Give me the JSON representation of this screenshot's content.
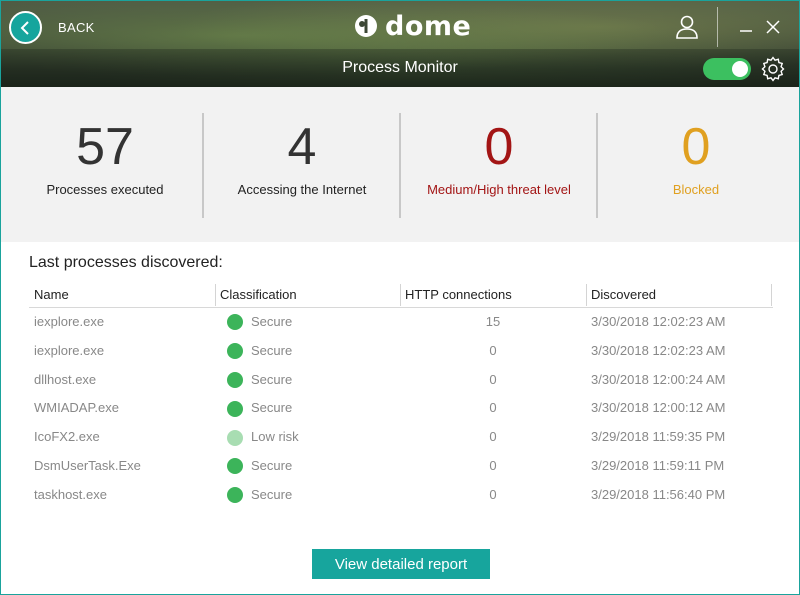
{
  "header": {
    "back_label": "BACK",
    "brand": "dome",
    "page_title": "Process Monitor",
    "toggle_on": true
  },
  "stats": [
    {
      "value": "57",
      "label": "Processes executed",
      "color": "#333333",
      "label_color": "#222222"
    },
    {
      "value": "4",
      "label": "Accessing the Internet",
      "color": "#333333",
      "label_color": "#222222"
    },
    {
      "value": "0",
      "label": "Medium/High threat level",
      "color": "#a31515",
      "label_color": "#a31515"
    },
    {
      "value": "0",
      "label": "Blocked",
      "color": "#e0a020",
      "label_color": "#e0a020"
    }
  ],
  "table": {
    "title": "Last processes discovered:",
    "columns": [
      "Name",
      "Classification",
      "HTTP connections",
      "Discovered"
    ],
    "rows": [
      {
        "name": "iexplore.exe",
        "classification": "Secure",
        "http": "15",
        "discovered": "3/30/2018 12:02:23 AM"
      },
      {
        "name": "iexplore.exe",
        "classification": "Secure",
        "http": "0",
        "discovered": "3/30/2018 12:02:23 AM"
      },
      {
        "name": "dllhost.exe",
        "classification": "Secure",
        "http": "0",
        "discovered": "3/30/2018 12:00:24 AM"
      },
      {
        "name": "WMIADAP.exe",
        "classification": "Secure",
        "http": "0",
        "discovered": "3/30/2018 12:00:12 AM"
      },
      {
        "name": "IcoFX2.exe",
        "classification": "Low risk",
        "http": "0",
        "discovered": "3/29/2018 11:59:35 PM"
      },
      {
        "name": "DsmUserTask.Exe",
        "classification": "Secure",
        "http": "0",
        "discovered": "3/29/2018 11:59:11 PM"
      },
      {
        "name": "taskhost.exe",
        "classification": "Secure",
        "http": "0",
        "discovered": "3/29/2018 11:56:40 PM"
      }
    ]
  },
  "status_colors": {
    "Secure": "#3cb45a",
    "Low risk": "#a8ddb2"
  },
  "footer": {
    "report_button": "View detailed report"
  },
  "colors": {
    "accent": "#17a59d"
  }
}
